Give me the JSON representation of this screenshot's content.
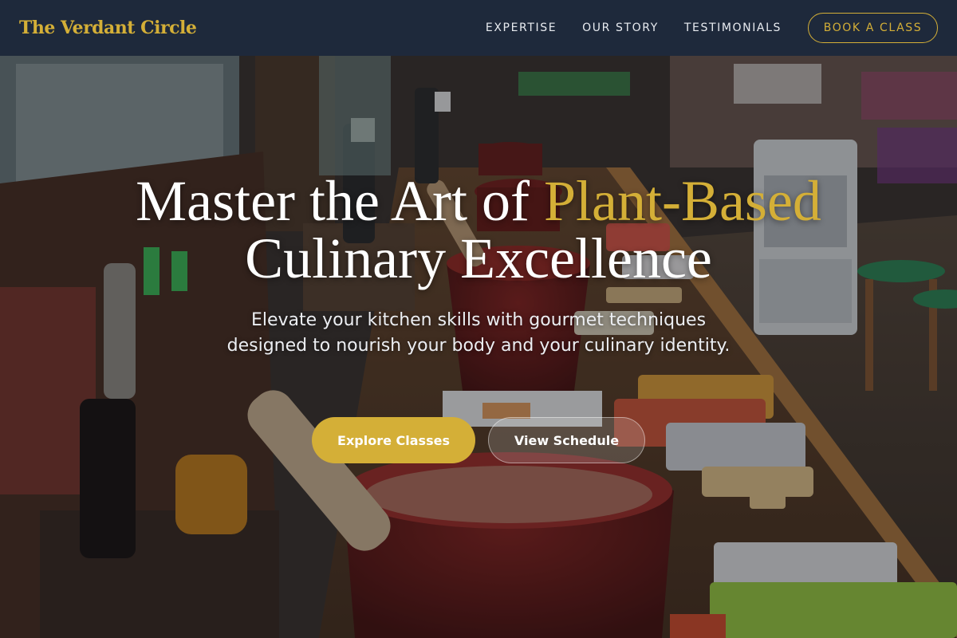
{
  "header": {
    "brand": "The Verdant Circle",
    "nav": [
      {
        "label": "EXPERTISE"
      },
      {
        "label": "OUR STORY"
      },
      {
        "label": "TESTIMONIALS"
      }
    ],
    "cta_label": "BOOK A CLASS"
  },
  "hero": {
    "title_part1": "Master the Art of ",
    "title_accent": "Plant-Based",
    "title_line2": "Culinary Excellence",
    "subtitle": "Elevate your kitchen skills with gourmet techniques designed to nourish your body and your culinary identity.",
    "primary_button": "Explore Classes",
    "secondary_button": "View Schedule"
  },
  "colors": {
    "header_bg": "#1e293b",
    "accent_gold": "#d4af37",
    "text_white": "#ffffff"
  }
}
